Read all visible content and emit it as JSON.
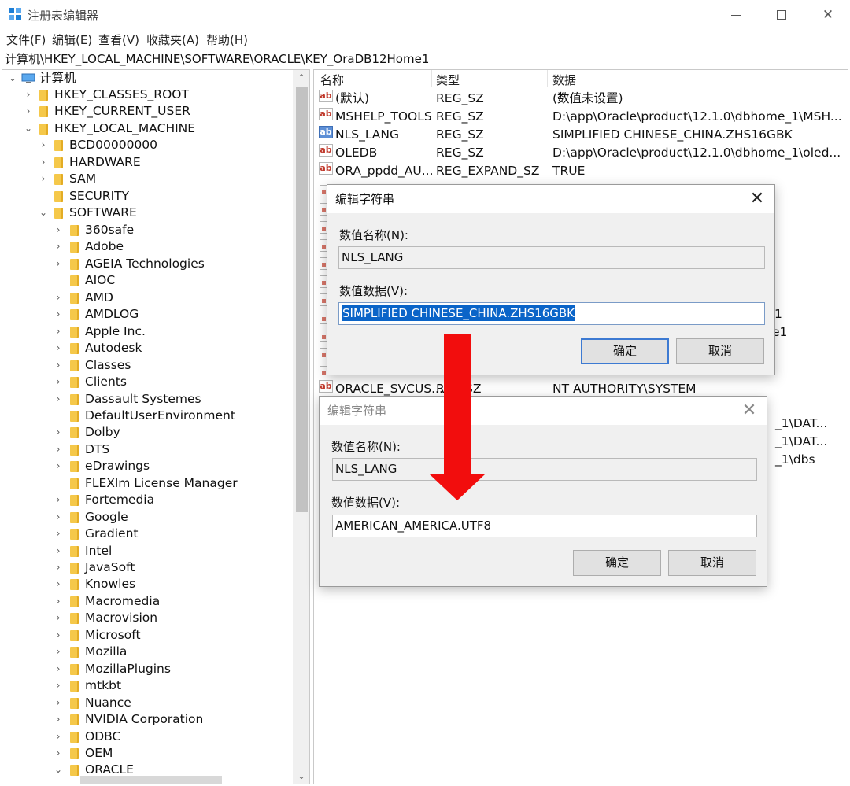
{
  "window": {
    "title": "注册表编辑器"
  },
  "menu": [
    "文件(F)",
    "编辑(E)",
    "查看(V)",
    "收藏夹(A)",
    "帮助(H)"
  ],
  "address": "计算机\\HKEY_LOCAL_MACHINE\\SOFTWARE\\ORACLE\\KEY_OraDB12Home1",
  "tree": {
    "root": "计算机",
    "hives": [
      "HKEY_CLASSES_ROOT",
      "HKEY_CURRENT_USER",
      "HKEY_LOCAL_MACHINE"
    ],
    "hklm_children": [
      "BCD00000000",
      "HARDWARE",
      "SAM",
      "SECURITY",
      "SOFTWARE"
    ],
    "software_children": [
      "360safe",
      "Adobe",
      "AGEIA Technologies",
      "AIOC",
      "AMD",
      "AMDLOG",
      "Apple Inc.",
      "Autodesk",
      "Classes",
      "Clients",
      "Dassault Systemes",
      "DefaultUserEnvironment",
      "Dolby",
      "DTS",
      "eDrawings",
      "FLEXlm License Manager",
      "Fortemedia",
      "Google",
      "Gradient",
      "Intel",
      "JavaSoft",
      "Knowles",
      "Macromedia",
      "Macrovision",
      "Microsoft",
      "Mozilla",
      "MozillaPlugins",
      "mtkbt",
      "Nuance",
      "NVIDIA Corporation",
      "ODBC",
      "OEM",
      "ORACLE"
    ]
  },
  "list": {
    "headers": {
      "name": "名称",
      "type": "类型",
      "data": "数据"
    },
    "rows": [
      {
        "name": "(默认)",
        "type": "REG_SZ",
        "data": "(数值未设置)"
      },
      {
        "name": "MSHELP_TOOLS",
        "type": "REG_SZ",
        "data": "D:\\app\\Oracle\\product\\12.1.0\\dbhome_1\\MSH..."
      },
      {
        "name": "NLS_LANG",
        "type": "REG_SZ",
        "data": "SIMPLIFIED CHINESE_CHINA.ZHS16GBK"
      },
      {
        "name": "OLEDB",
        "type": "REG_SZ",
        "data": "D:\\app\\Oracle\\product\\12.1.0\\dbhome_1\\oled..."
      },
      {
        "name": "ORA_ppdd_AU...",
        "type": "REG_EXPAND_SZ",
        "data": "TRUE"
      },
      {
        "name": "ORACLE_SVCUS...",
        "type": "R",
        "type2": "SZ",
        "data": "NT AUTHORITY\\SYSTEM"
      }
    ],
    "partial_data": [
      "1",
      "e1",
      "_1\\DAT...",
      "_1\\DAT...",
      "_1\\dbs"
    ]
  },
  "dialog1": {
    "title": "编辑字符串",
    "name_label": "数值名称(N):",
    "name_value": "NLS_LANG",
    "data_label": "数值数据(V):",
    "data_value": "SIMPLIFIED CHINESE_CHINA.ZHS16GBK",
    "ok": "确定",
    "cancel": "取消"
  },
  "dialog2": {
    "title": "编辑字符串",
    "name_label": "数值名称(N):",
    "name_value": "NLS_LANG",
    "data_label": "数值数据(V):",
    "data_value": "AMERICAN_AMERICA.UTF8",
    "ok": "确定",
    "cancel": "取消"
  },
  "colors": {
    "accent": "#0a64c8",
    "arrow": "#f20d0d",
    "folder": "#f5c84a"
  }
}
